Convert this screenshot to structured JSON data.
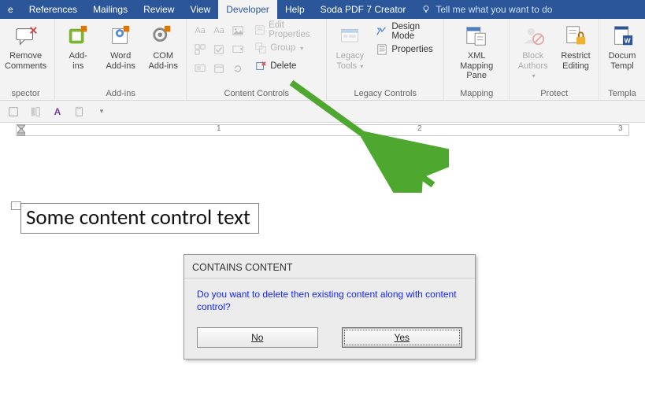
{
  "tabs": {
    "items": [
      "e",
      "References",
      "Mailings",
      "Review",
      "View",
      "Developer",
      "Help",
      "Soda PDF 7 Creator"
    ],
    "active_index": 5,
    "tellme": "Tell me what you want to do"
  },
  "ribbon": {
    "inspector": {
      "remove_comments": "Remove\nComments",
      "group_label": "spector"
    },
    "addins": {
      "addins": "Add-\nins",
      "word_addins": "Word\nAdd-ins",
      "com_addins": "COM\nAdd-ins",
      "group_label": "Add-ins"
    },
    "controls": {
      "edit_properties": "Edit Properties",
      "group": "Group",
      "delete": "Delete",
      "group_label": "Content Controls"
    },
    "legacy": {
      "legacy_tools": "Legacy\nTools",
      "design_mode": "Design Mode",
      "properties": "Properties",
      "group_label": "Legacy Controls"
    },
    "mapping": {
      "xml_mapping": "XML Mapping\nPane",
      "group_label": "Mapping"
    },
    "protect": {
      "block_authors": "Block\nAuthors",
      "restrict_editing": "Restrict\nEditing",
      "group_label": "Protect"
    },
    "templates": {
      "doc_template": "Docum\nTempl",
      "group_label": "Templa"
    }
  },
  "minibar": {
    "letter": "A"
  },
  "ruler": {
    "n1": "1",
    "n2": "2",
    "n3": "3"
  },
  "document": {
    "cc_text": "Some content control text"
  },
  "dialog": {
    "title": "CONTAINS CONTENT",
    "message": "Do you want to delete then existing content along with content control?",
    "no": "No",
    "yes": "Yes"
  }
}
